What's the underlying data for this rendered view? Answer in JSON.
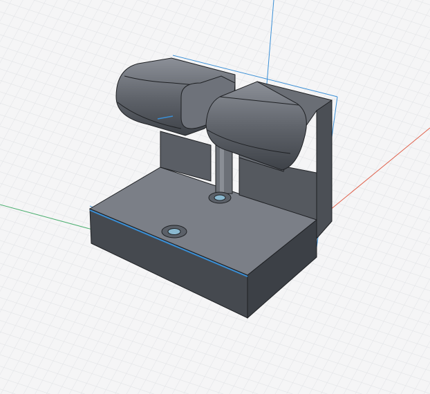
{
  "viewport": {
    "background": "#f5f5f6",
    "grid_minor_color": "#dfe1e4",
    "grid_major_color": "#c9ccd1"
  },
  "axes": {
    "x_axis_color": "#e0604a",
    "y_axis_color": "#4caf70",
    "z_axis_color": "#3a8fd6"
  },
  "model": {
    "face_top": "#7b7f87",
    "face_front": "#45494f",
    "face_side": "#5a5e65",
    "edge_color": "#1e2023",
    "selection_color": "#3a8fd6",
    "hole_color": "#8ab8cf"
  }
}
